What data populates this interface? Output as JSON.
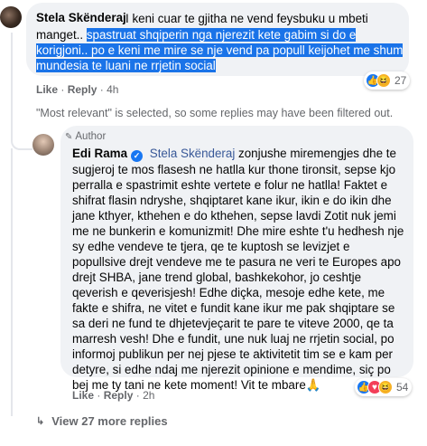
{
  "comment1": {
    "author": "Stela Skënderaj",
    "lines": [
      {
        "pre": "I keni cuar te gjitha ne vend feysbuku u mbeti",
        "hl": ""
      },
      {
        "pre": "manget.. ",
        "hl": "spastruat shqiperin nga njerezit kete gabim si do e"
      },
      {
        "pre": "",
        "hl": "korigjoni.. po e keni me mire se nje vend pa popull keijohet me shum"
      },
      {
        "pre": "",
        "hl": "mundesia te luani ne rrjetin social"
      }
    ],
    "actions": {
      "like": "Like",
      "reply": "Reply",
      "time": "4h"
    },
    "reaction_count": "27",
    "reactions": [
      "like",
      "haha"
    ]
  },
  "filter_notice": "\"Most relevant\" is selected, so some replies may have been filtered out.",
  "reply": {
    "badge": "Author",
    "author": "Edi Rama",
    "mention": "Stela Skënderaj",
    "first_line_rest": " zonjushe miremengjes dhe te",
    "lines": [
      "sugjeroj te mos flasesh ne hatlla kur thone tironsit, sepse kjo",
      "perralla e spastrimit eshte vertete e folur ne hatlla! Faktet e",
      "shifrat flasin ndryshe, shqiptaret kane ikur, ikin e do ikin dhe",
      "jane kthyer, kthehen e do kthehen, sepse lavdi Zotit nuk jemi",
      "me ne bunkerin e komunizmit! Dhe mire eshte t'u hedhesh nje",
      "sy edhe vendeve te tjera, qe te kuptosh se levizjet e",
      "popullsive drejt vendeve me te pasura ne veri te Europes apo",
      "drejt SHBA, jane trend global, bashkekohor, jo ceshtje",
      "qeverish e qeverisjesh! Edhe diçka, mesoje edhe kete, me",
      "fakte e shifra, ne vitet e fundit kane ikur me pak shqiptare se",
      "sa deri ne fund te dhjetevjeçarit te pare te viteve 2000, qe ta",
      "marresh vesh! Dhe e fundit, une nuk luaj ne rrjetin social, po",
      "informoj publikun per nej pjese te aktivitetit tim se e kam per",
      "detyre, si edhe ndaj me njerezit opinione e mendime, siç po",
      "bej me ty tani ne kete moment! Vit te mbare🙏"
    ],
    "actions": {
      "like": "Like",
      "reply": "Reply",
      "time": "2h"
    },
    "reaction_count": "54",
    "reactions": [
      "like",
      "love",
      "haha"
    ]
  },
  "view_more": "View 27 more replies"
}
